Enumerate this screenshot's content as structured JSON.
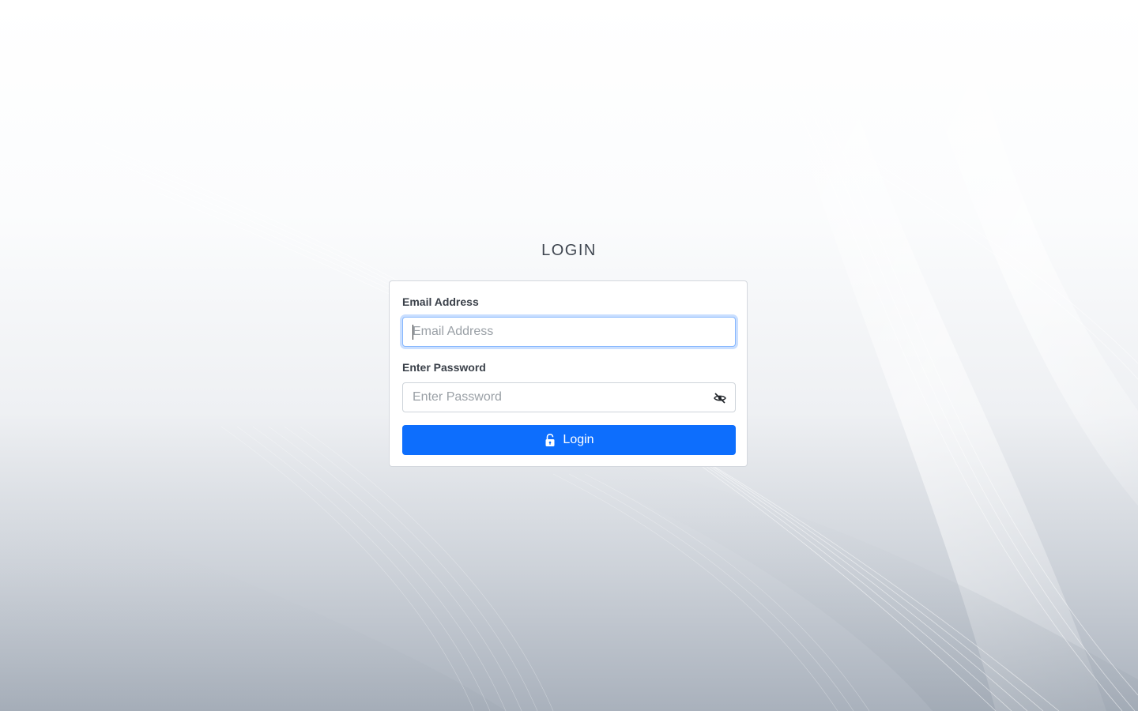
{
  "page": {
    "title": "LOGIN"
  },
  "form": {
    "email": {
      "label": "Email Address",
      "placeholder": "Email Address",
      "value": ""
    },
    "password": {
      "label": "Enter Password",
      "placeholder": "Enter Password",
      "value": "",
      "toggle_icon": "eye-slash-icon"
    },
    "submit": {
      "label": "Login",
      "icon": "unlock-icon"
    }
  },
  "colors": {
    "primary": "#0d6efd",
    "title_text": "#3f4650",
    "label_text": "#3a4049",
    "focus_border": "#86b7fe"
  }
}
